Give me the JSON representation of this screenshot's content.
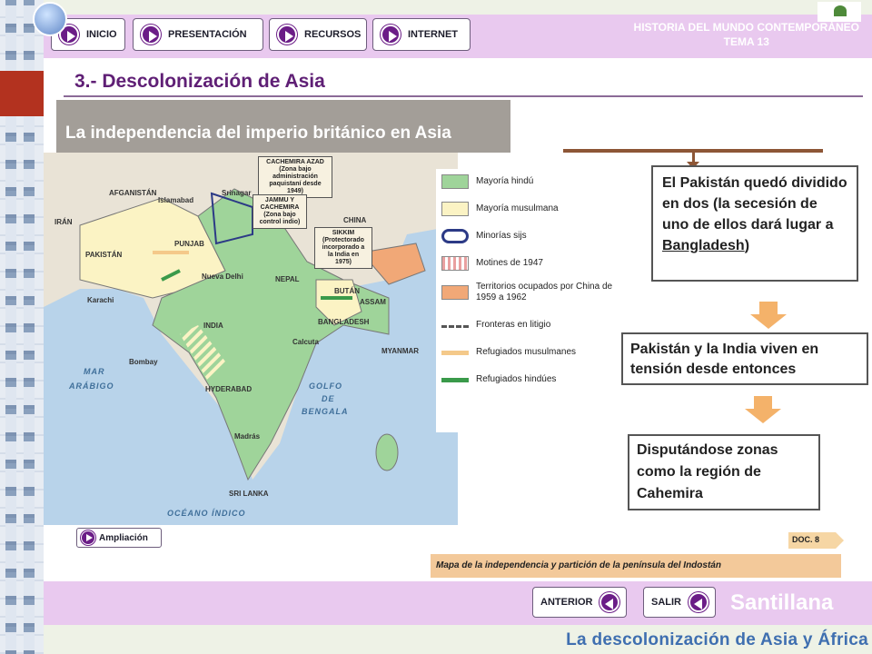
{
  "nav": {
    "buttons": [
      "INICIO",
      "PRESENTACIÓN",
      "RECURSOS",
      "INTERNET"
    ],
    "course_title": "HISTORIA DEL MUNDO CONTEMPORÁNEO",
    "course_subtitle": "TEMA 13"
  },
  "section_title": "3.- Descolonización de Asia",
  "map_title": "La independencia del imperio británico en Asia",
  "map": {
    "labels": [
      "AFGANISTÁN",
      "IRÁN",
      "PAKISTÁN",
      "INDIA",
      "CHINA",
      "NEPAL",
      "BUTÁN",
      "BANGLADESH",
      "ASSAM",
      "MYANMAR",
      "SRI LANKA",
      "Karachi",
      "Bombay",
      "Calcuta",
      "Madrás",
      "Nueva Delhi",
      "HYDERABAD",
      "PUNJAB",
      "Srinagar",
      "Islamabad"
    ],
    "seas": [
      "MAR",
      "ARÁBIGO",
      "GOLFO",
      "DE",
      "BENGALA",
      "OCÉANO ÍNDICO"
    ],
    "callouts": [
      {
        "title": "CACHEMIRA AZAD",
        "text": "(Zona bajo administración paquistaní desde 1949)"
      },
      {
        "title": "JAMMU Y CACHEMIRA",
        "text": "(Zona bajo control indio)"
      },
      {
        "title": "SIKKIM",
        "text": "(Protectorado incorporado a la India en 1975)"
      }
    ]
  },
  "legend": [
    {
      "label": "Mayoría hindú",
      "color": "#9fd49a"
    },
    {
      "label": "Mayoría musulmana",
      "color": "#fbf3c4"
    },
    {
      "label": "Minorías sijs",
      "color": "#2c3a86"
    },
    {
      "label": "Motines de 1947",
      "color": "#e9a0a0"
    },
    {
      "label": "Territorios ocupados por China de 1959 a 1962",
      "color": "#f1a877"
    },
    {
      "label": "Fronteras en litigio",
      "color": "#555555"
    },
    {
      "label": "Refugiados musulmanes",
      "color": "#f4c98a"
    },
    {
      "label": "Refugiados hindúes",
      "color": "#3a9a4a"
    }
  ],
  "box1": {
    "text": "El Pakistán quedó dividido en dos (la secesión de uno de ellos dará lugar a ",
    "link": "Bangladesh",
    "tail": ")"
  },
  "box2": "Pakistán y la India viven en tensión desde entonces",
  "box3": "Disputándose zonas como la región de Cahemira",
  "ampliacion": "Ampliación",
  "doc_tag": "DOC. 8",
  "caption": "Mapa de la independencia y partición de la península del Indostán",
  "bottom": {
    "anterior": "ANTERIOR",
    "salir": "SALIR",
    "brand": "Santillana"
  },
  "footer_title": "La descolonización de Asia y África",
  "colors": {
    "accent": "#e9c9ef",
    "title": "#5f1f75",
    "arrow": "#f4b26a",
    "footer": "#3f6fb0"
  }
}
